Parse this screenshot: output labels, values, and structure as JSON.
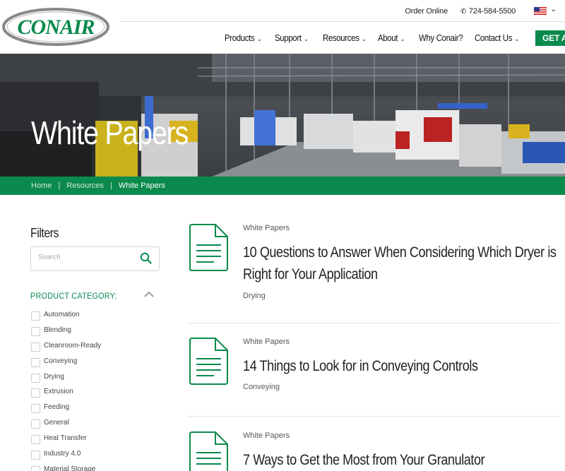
{
  "header": {
    "logo_text": "CONAIR",
    "order_online": "Order Online",
    "phone": "724-584-5500",
    "nav": [
      {
        "label": "Products",
        "dropdown": true
      },
      {
        "label": "Support",
        "dropdown": true
      },
      {
        "label": "Resources",
        "dropdown": true
      },
      {
        "label": "About",
        "dropdown": true
      },
      {
        "label": "Why Conair?",
        "dropdown": false
      },
      {
        "label": "Contact Us",
        "dropdown": true
      }
    ],
    "cta": "GET A C"
  },
  "hero": {
    "title": "White Papers"
  },
  "breadcrumb": {
    "home": "Home",
    "resources": "Resources",
    "current": "White Papers",
    "separator": "|"
  },
  "sidebar": {
    "title": "Filters",
    "search_placeholder": "Search",
    "category_heading": "PRODUCT CATEGORY:",
    "categories": [
      "Automation",
      "Blending",
      "Cleanroom-Ready",
      "Conveying",
      "Drying",
      "Extrusion",
      "Feeding",
      "General",
      "Heat Transfer",
      "Industry 4.0",
      "Material Storage"
    ]
  },
  "results": [
    {
      "type": "White Papers",
      "title": "10 Questions to Answer When Considering Which Dryer is Right for Your Application",
      "tag": "Drying"
    },
    {
      "type": "White Papers",
      "title": "14 Things to Look for in Conveying Controls",
      "tag": "Conveying"
    },
    {
      "type": "White Papers",
      "title": "7 Ways to Get the Most from Your Granulator",
      "tag": ""
    }
  ],
  "colors": {
    "brand_green": "#0a8a4c"
  }
}
